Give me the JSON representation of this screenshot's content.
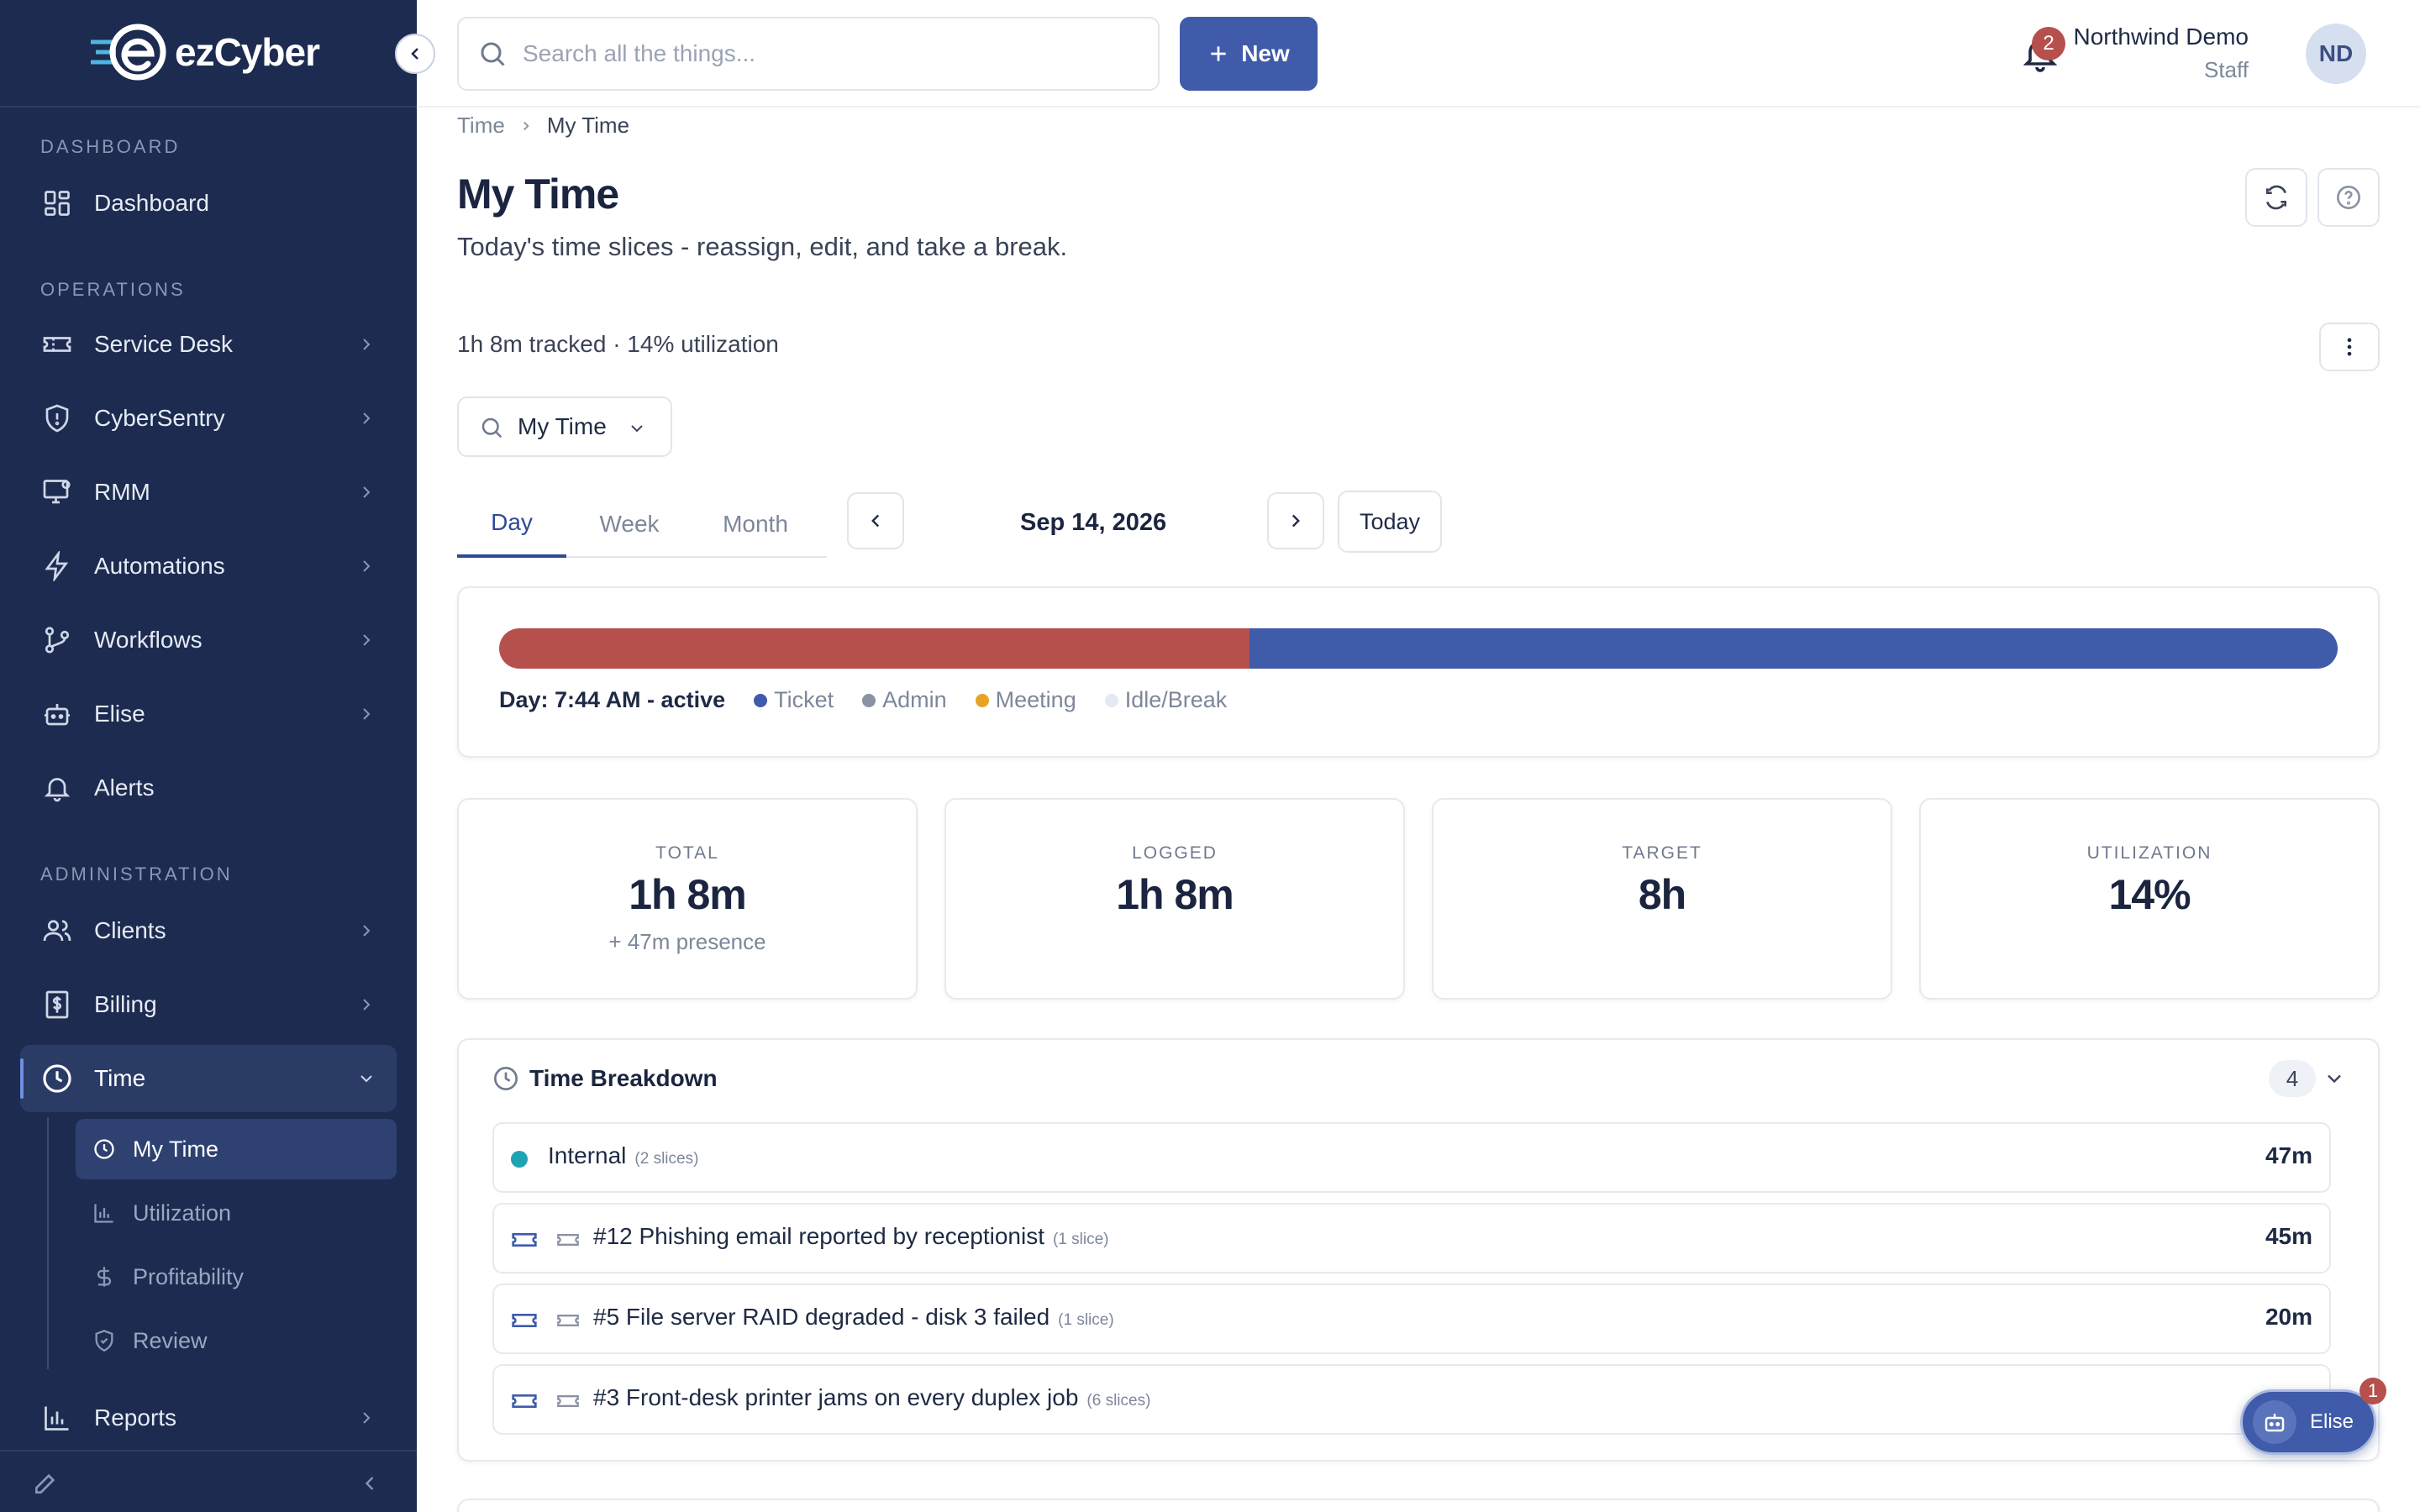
{
  "app": {
    "logo_text": "ezCyber"
  },
  "sidebar": {
    "sections": {
      "dashboard": "DASHBOARD",
      "operations": "OPERATIONS",
      "administration": "ADMINISTRATION"
    },
    "items": {
      "dashboard": "Dashboard",
      "service_desk": "Service Desk",
      "cybersentry": "CyberSentry",
      "rmm": "RMM",
      "automations": "Automations",
      "workflows": "Workflows",
      "elise": "Elise",
      "alerts": "Alerts",
      "clients": "Clients",
      "billing": "Billing",
      "time": "Time",
      "reports": "Reports"
    },
    "time_sub": {
      "my_time": "My Time",
      "utilization": "Utilization",
      "profitability": "Profitability",
      "review": "Review"
    }
  },
  "topbar": {
    "search_placeholder": "Search all the things...",
    "new_label": "New",
    "notification_count": "2",
    "user_name": "Northwind Demo",
    "user_role": "Staff",
    "avatar_initials": "ND"
  },
  "breadcrumb": {
    "parent": "Time",
    "current": "My Time"
  },
  "page": {
    "title": "My Time",
    "subtitle": "Today's time slices - reassign, edit, and take a break.",
    "summary": "1h 8m tracked · 14% utilization"
  },
  "filter": {
    "label": "My Time"
  },
  "tabs": {
    "day": "Day",
    "week": "Week",
    "month": "Month"
  },
  "date_nav": {
    "date": "Sep 14, 2026",
    "today": "Today"
  },
  "timeline": {
    "day_label": "Day: 7:44 AM - active",
    "segments": [
      {
        "type": "Idle/Break",
        "fraction": 0.408,
        "color": "#b6504d"
      },
      {
        "type": "Ticket",
        "fraction": 0.592,
        "color": "#3f5ba9"
      }
    ],
    "legend": {
      "ticket": "Ticket",
      "admin": "Admin",
      "meeting": "Meeting",
      "idle": "Idle/Break"
    },
    "colors": {
      "ticket": "#3f5ba9",
      "admin": "#8a93a5",
      "meeting": "#e8a325",
      "idle": "#e4e8f0"
    }
  },
  "stats": {
    "total_label": "TOTAL",
    "total_value": "1h 8m",
    "total_sub": "+ 47m presence",
    "logged_label": "LOGGED",
    "logged_value": "1h 8m",
    "target_label": "TARGET",
    "target_value": "8h",
    "utilization_label": "UTILIZATION",
    "utilization_value": "14%"
  },
  "breakdown": {
    "title": "Time Breakdown",
    "count": "4",
    "rows": [
      {
        "title": "Internal",
        "slices": "(2 slices)",
        "duration": "47m"
      },
      {
        "title": "#12 Phishing email reported by receptionist",
        "slices": "(1 slice)",
        "duration": "45m"
      },
      {
        "title": "#5 File server RAID degraded - disk 3 failed",
        "slices": "(1 slice)",
        "duration": "20m"
      },
      {
        "title": "#3 Front-desk printer jams on every duplex job",
        "slices": "(6 slices)",
        "duration": ""
      }
    ]
  },
  "elise": {
    "label": "Elise",
    "badge": "1"
  }
}
